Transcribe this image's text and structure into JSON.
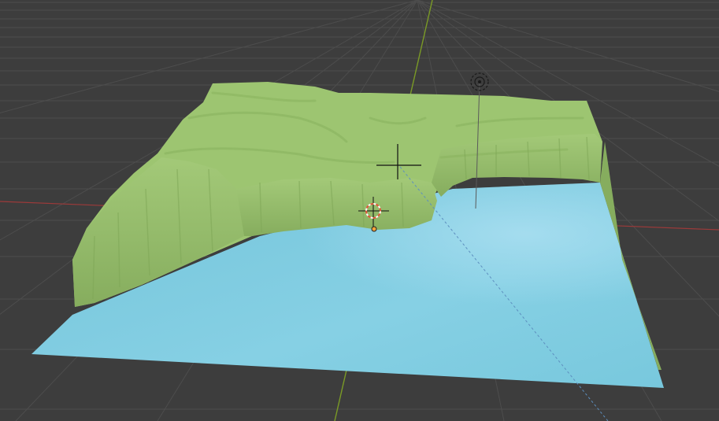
{
  "viewport": {
    "background": "#3d3d3d",
    "grid_color": "#505050",
    "x_axis_color": "#a83c3c",
    "y_axis_color": "#7b9c2a"
  },
  "scene": {
    "terrain": {
      "top_color": "#9cc470",
      "cliff_color": "#8fb866",
      "shade_color": "#7ea65a"
    },
    "water": {
      "color": "#7bcde0",
      "highlight": "#93d9eb"
    },
    "icons": [
      "3d-cursor-icon",
      "object-origin-icon",
      "light-icon",
      "camera-view-line"
    ]
  }
}
